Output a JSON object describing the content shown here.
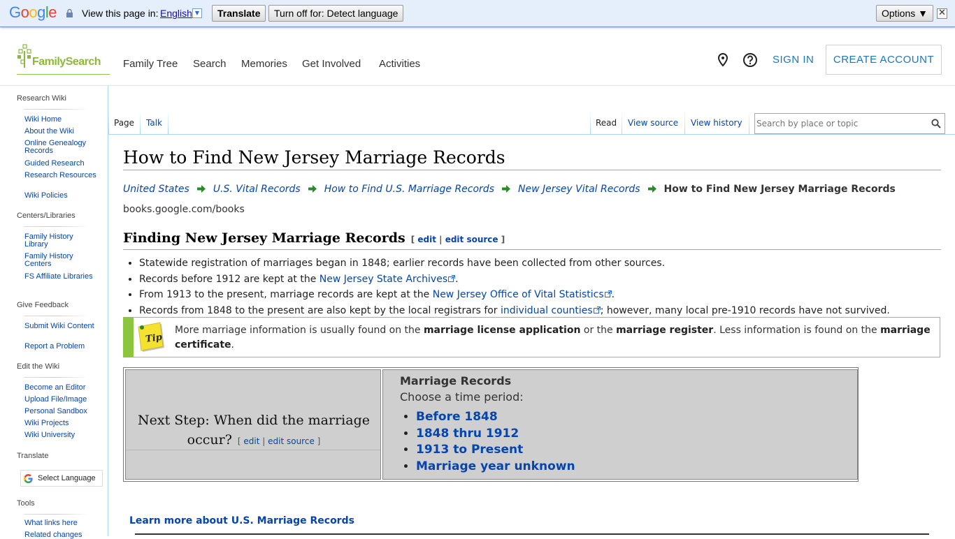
{
  "translate_bar": {
    "logo": "Google",
    "prompt": "View this page in:",
    "language": "English",
    "translate_button": "Translate",
    "turn_off_button": "Turn off for: Detect language",
    "options_button": "Options ▼",
    "close": "✕"
  },
  "header": {
    "logo_text": "FamilySearch",
    "nav": [
      "Family Tree",
      "Search",
      "Memories",
      "Get Involved",
      "Activities"
    ],
    "sign_in": "SIGN IN",
    "create_account": "CREATE ACCOUNT"
  },
  "sidebar": {
    "sections": [
      {
        "heading": "Research Wiki",
        "items": [
          "Wiki Home",
          "About the Wiki",
          "Online Genealogy Records",
          "Guided Research",
          "Research Resources",
          "Wiki Policies"
        ]
      },
      {
        "heading": "Centers/Libraries",
        "items": [
          "Family History Library",
          "Family History Centers",
          "FS Affiliate Libraries"
        ]
      },
      {
        "heading": "Give Feedback",
        "items": [
          "Submit Wiki Content",
          "Report a Problem"
        ]
      },
      {
        "heading": "Edit the Wiki",
        "items": [
          "Become an Editor",
          "Upload File/Image",
          "Personal Sandbox",
          "Wiki Projects",
          "Wiki University"
        ]
      },
      {
        "heading": "Translate",
        "items": []
      },
      {
        "heading": "Tools",
        "items": [
          "What links here",
          "Related changes"
        ]
      }
    ],
    "translate_widget": "Select Language"
  },
  "tabs": {
    "page": "Page",
    "talk": "Talk",
    "read": "Read",
    "view_source": "View source",
    "view_history": "View history",
    "search_placeholder": "Search by place or topic"
  },
  "article": {
    "title": "How to Find New Jersey Marriage Records",
    "breadcrumbs": [
      "United States",
      "U.S. Vital Records",
      "How to Find U.S. Marriage Records",
      "New Jersey Vital Records"
    ],
    "breadcrumb_current": "How to Find New Jersey Marriage Records",
    "source_url": "books.google.com/books",
    "section_heading": "Finding New Jersey Marriage Records",
    "edit_open": "[ ",
    "edit": "edit",
    "edit_sep": " | ",
    "edit_source": "edit source",
    "edit_close": " ]",
    "bullets": {
      "b1": "Statewide registration of marriages began in 1848; earlier records have been collected from other sources.",
      "b2_pre": "Records before 1912 are kept at the ",
      "b2_link": "New Jersey State Archives",
      "b2_post": ".",
      "b3_pre": "From 1913 to the present, marriage records are kept at the ",
      "b3_link": "New Jersey Office of Vital Statistics",
      "b3_post": ".",
      "b4_pre": "Records from 1848 to the present are also kept by the local registrars for ",
      "b4_link": "individual counties",
      "b4_post": "; however, many local pre-1910 records have not survived."
    },
    "tip": {
      "icon_label": "Tip",
      "t1": "More marriage information is usually found on the ",
      "b1": "marriage license application",
      "t2": " or the ",
      "b2": "marriage register",
      "t3": ". Less information is found on the ",
      "b3": "marriage certificate",
      "t4": "."
    },
    "next_step": "Next Step: When did the marriage occur?",
    "marriage_records": {
      "title": "Marriage Records",
      "subtitle": "Choose a time period:",
      "periods": [
        "Before 1848",
        "1848 thru 1912",
        "1913 to Present",
        "Marriage year unknown"
      ]
    },
    "learn_more": "Learn more about U.S. Marriage Records"
  }
}
